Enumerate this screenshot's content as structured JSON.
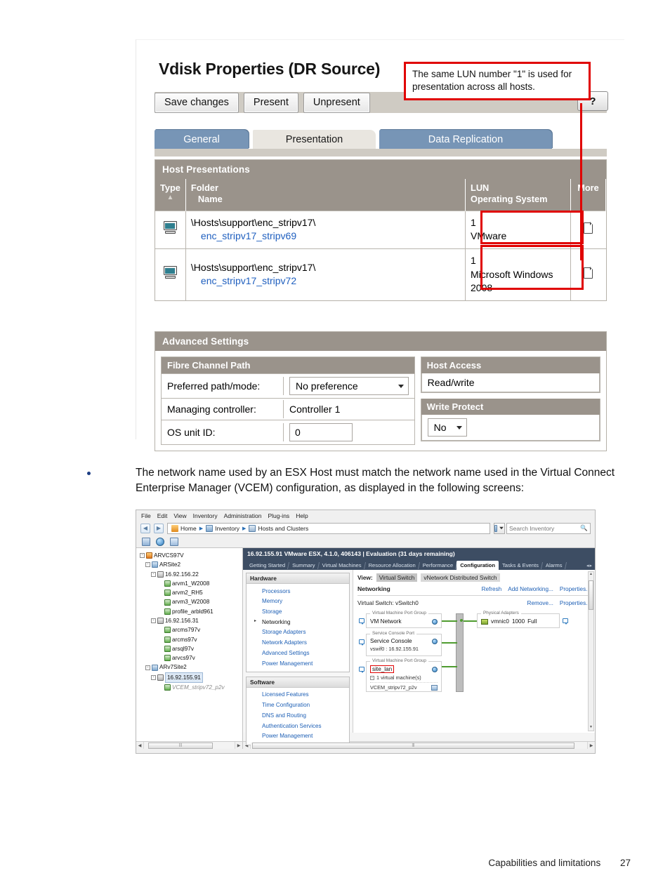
{
  "figure1": {
    "title": "Vdisk Properties (DR Source)",
    "buttons": [
      "Save changes",
      "Present",
      "Unpresent"
    ],
    "help_label": "?",
    "tabs": [
      {
        "label": "General",
        "selected": false
      },
      {
        "label": "Presentation",
        "selected": true
      },
      {
        "label": "Data Replication",
        "selected": false
      }
    ],
    "host_presentations": {
      "section_title": "Host Presentations",
      "columns": {
        "type": "Type",
        "folder": "Folder",
        "name": "Name",
        "lun": "LUN",
        "os": "Operating System",
        "more": "More"
      },
      "rows": [
        {
          "type_icon": "host-computer-icon",
          "folder": "\\Hosts\\support\\enc_stripv17\\",
          "name": "enc_stripv17_stripv69",
          "lun": "1",
          "os": "VMware",
          "more_icon": "document-icon"
        },
        {
          "type_icon": "host-computer-icon",
          "folder": "\\Hosts\\support\\enc_stripv17\\",
          "name": "enc_stripv17_stripv72",
          "lun": "1",
          "os": "Microsoft Windows 2008",
          "more_icon": "document-icon"
        }
      ]
    },
    "advanced_settings": {
      "section_title": "Advanced Settings",
      "fibre_channel_path": {
        "title": "Fibre Channel Path",
        "rows": [
          {
            "label": "Preferred path/mode:",
            "value": "No preference",
            "control": "select"
          },
          {
            "label": "Managing controller:",
            "value": "Controller 1",
            "control": "text"
          },
          {
            "label": "OS unit ID:",
            "value": "0",
            "control": "input"
          }
        ]
      },
      "host_access": {
        "title": "Host Access",
        "value": "Read/write"
      },
      "write_protect": {
        "title": "Write Protect",
        "value": "No"
      }
    },
    "annotation": {
      "text": "The same LUN number \"1\" is used for presentation across all hosts.",
      "color": "#e00000"
    }
  },
  "bullet": {
    "text": "The network name used by an ESX Host must match the network name used in the Virtual Connect Enterprise Manager (VCEM) configuration, as displayed in the following screens:"
  },
  "figure2": {
    "menubar": [
      "File",
      "Edit",
      "View",
      "Inventory",
      "Administration",
      "Plug-ins",
      "Help"
    ],
    "breadcrumb": [
      "Home",
      "Inventory",
      "Hosts and Clusters"
    ],
    "search": {
      "placeholder": "Search Inventory"
    },
    "tree": [
      {
        "indent": 0,
        "label": "ARVCS97V",
        "icon": "vcenter-icon",
        "expander": "-"
      },
      {
        "indent": 1,
        "label": "ARSite2",
        "icon": "datacenter-icon",
        "expander": "-"
      },
      {
        "indent": 2,
        "label": "16.92.156.22",
        "icon": "host-icon",
        "expander": "-"
      },
      {
        "indent": 3,
        "label": "arvm1_W2008",
        "icon": "vm-icon",
        "expander": ""
      },
      {
        "indent": 3,
        "label": "arvm2_RH5",
        "icon": "vm-icon",
        "expander": ""
      },
      {
        "indent": 3,
        "label": "arvm3_W2008",
        "icon": "vm-icon",
        "expander": ""
      },
      {
        "indent": 3,
        "label": "profile_arbld961",
        "icon": "vm-icon",
        "expander": ""
      },
      {
        "indent": 2,
        "label": "16.92.156.31",
        "icon": "host-icon",
        "expander": "-"
      },
      {
        "indent": 3,
        "label": "arcms797v",
        "icon": "vm-icon",
        "expander": ""
      },
      {
        "indent": 3,
        "label": "arcms97v",
        "icon": "vm-icon",
        "expander": ""
      },
      {
        "indent": 3,
        "label": "arsql97v",
        "icon": "vm-icon",
        "expander": ""
      },
      {
        "indent": 3,
        "label": "arvcs97v",
        "icon": "vm-icon",
        "expander": ""
      },
      {
        "indent": 1,
        "label": "ARv7Site2",
        "icon": "datacenter-icon",
        "expander": "-"
      },
      {
        "indent": 2,
        "label": "16.92.155.91",
        "icon": "host-icon",
        "expander": "-",
        "selected": true
      },
      {
        "indent": 3,
        "label": "VCEM_stripv72_p2v",
        "icon": "vm-icon",
        "greyed": true
      }
    ],
    "content_header": "16.92.155.91 VMware ESX, 4.1.0, 406143  |  Evaluation (31 days remaining)",
    "tabs": [
      {
        "label": "Getting Started",
        "active": false
      },
      {
        "label": "Summary",
        "active": false
      },
      {
        "label": "Virtual Machines",
        "active": false
      },
      {
        "label": "Resource Allocation",
        "active": false
      },
      {
        "label": "Performance",
        "active": false
      },
      {
        "label": "Configuration",
        "active": true
      },
      {
        "label": "Tasks & Events",
        "active": false
      },
      {
        "label": "Alarms",
        "active": false
      }
    ],
    "hardware_panel": {
      "title": "Hardware",
      "items": [
        {
          "label": "Processors",
          "current": false
        },
        {
          "label": "Memory",
          "current": false
        },
        {
          "label": "Storage",
          "current": false
        },
        {
          "label": "Networking",
          "current": true
        },
        {
          "label": "Storage Adapters",
          "current": false
        },
        {
          "label": "Network Adapters",
          "current": false
        },
        {
          "label": "Advanced Settings",
          "current": false
        },
        {
          "label": "Power Management",
          "current": false
        }
      ]
    },
    "software_panel": {
      "title": "Software",
      "items": [
        {
          "label": "Licensed Features",
          "current": false
        },
        {
          "label": "Time Configuration",
          "current": false
        },
        {
          "label": "DNS and Routing",
          "current": false
        },
        {
          "label": "Authentication Services",
          "current": false
        },
        {
          "label": "Power Management",
          "current": false
        }
      ]
    },
    "networking": {
      "view_label": "View:",
      "view_options": [
        {
          "label": "Virtual Switch",
          "active": true
        },
        {
          "label": "vNetwork Distributed Switch",
          "active": false
        }
      ],
      "section_title": "Networking",
      "actions": [
        "Refresh",
        "Add Networking...",
        "Properties..."
      ],
      "switch_label": "Virtual Switch: vSwitch0",
      "switch_actions": [
        "Remove...",
        "Properties..."
      ],
      "groups": [
        {
          "caption": "Virtual Machine Port Group",
          "name": "VM Network",
          "sub": "",
          "highlight": false
        },
        {
          "caption": "Service Console Port",
          "name": "Service Console",
          "sub": "vswif0 : 16.92.155.91",
          "highlight": false
        },
        {
          "caption": "Virtual Machine Port Group",
          "name": "site_lan",
          "sub": "1 virtual machine(s)",
          "vm": "VCEM_stripv72_p2v",
          "highlight": true
        }
      ],
      "physical_adapters": {
        "caption": "Physical Adapters",
        "name": "vmnic0",
        "speed": "1000",
        "duplex": "Full"
      }
    }
  },
  "footer": {
    "chapter": "Capabilities and limitations",
    "page": "27"
  }
}
